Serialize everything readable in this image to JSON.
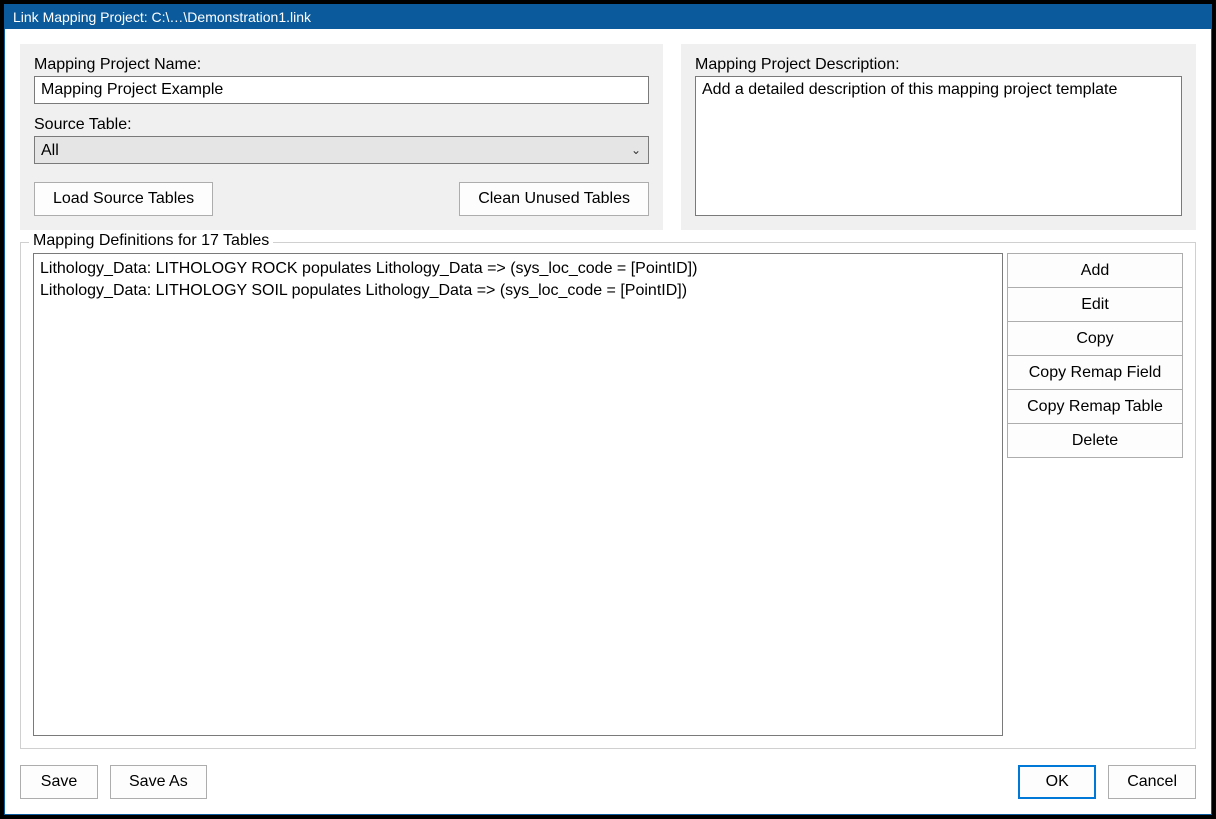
{
  "window": {
    "title": "Link Mapping Project: C:\\…\\Demonstration1.link"
  },
  "left": {
    "name_label": "Mapping Project Name:",
    "name_value": "Mapping Project Example",
    "source_label": "Source Table:",
    "source_value": "All",
    "load_btn": "Load Source Tables",
    "clean_btn": "Clean Unused Tables"
  },
  "right": {
    "desc_label": "Mapping Project Description:",
    "desc_value": "Add a detailed description of this mapping project template"
  },
  "definitions": {
    "legend": "Mapping Definitions for 17 Tables",
    "rows": [
      "Lithology_Data: LITHOLOGY ROCK populates Lithology_Data => (sys_loc_code = [PointID])",
      "Lithology_Data: LITHOLOGY SOIL populates Lithology_Data => (sys_loc_code = [PointID])"
    ],
    "actions": {
      "add": "Add",
      "edit": "Edit",
      "copy": "Copy",
      "copy_remap_field": "Copy Remap Field",
      "copy_remap_table": "Copy Remap Table",
      "delete": "Delete"
    }
  },
  "bottom": {
    "save": "Save",
    "save_as": "Save As",
    "ok": "OK",
    "cancel": "Cancel"
  }
}
